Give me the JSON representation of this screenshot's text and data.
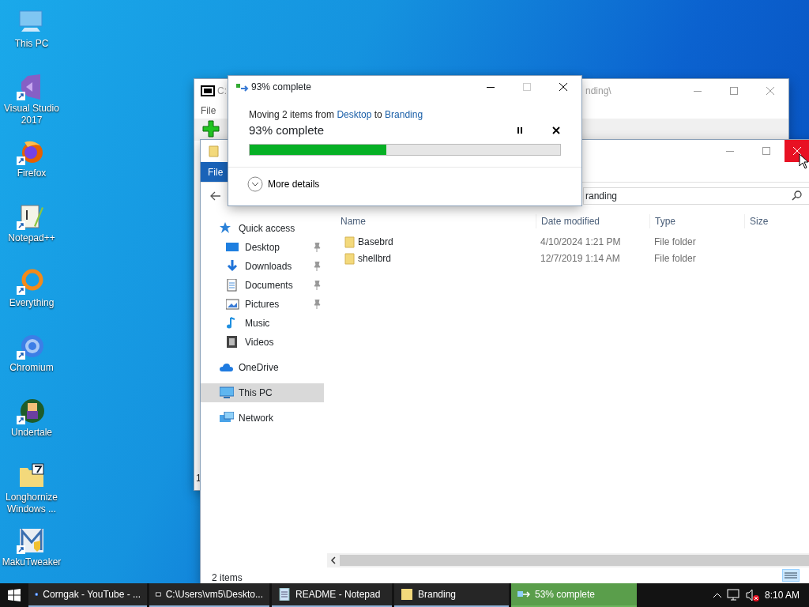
{
  "desktop_icons": [
    {
      "label": "This PC",
      "shortcut": false
    },
    {
      "label": "Visual Studio 2017",
      "shortcut": true
    },
    {
      "label": "Firefox",
      "shortcut": true
    },
    {
      "label": "Notepad++",
      "shortcut": true
    },
    {
      "label": "Everything",
      "shortcut": true
    },
    {
      "label": "Chromium",
      "shortcut": true
    },
    {
      "label": "Undertale",
      "shortcut": true
    },
    {
      "label": "Longhornize Windows ...",
      "shortcut": false
    },
    {
      "label": "MakuTweaker",
      "shortcut": true
    }
  ],
  "archive_window": {
    "title_start": "C:",
    "title_end": "nding\\",
    "menu": [
      "File"
    ],
    "status": "1"
  },
  "explorer": {
    "ribbon_tab": "File",
    "address": "randing",
    "close_hovered": true,
    "columns": [
      "Name",
      "Date modified",
      "Type",
      "Size"
    ],
    "nav": [
      {
        "label": "Quick access",
        "selected": false,
        "children": [
          {
            "label": "Desktop",
            "pinned": true,
            "selected": false
          },
          {
            "label": "Downloads",
            "pinned": true,
            "selected": false
          },
          {
            "label": "Documents",
            "pinned": true,
            "selected": false
          },
          {
            "label": "Pictures",
            "pinned": true,
            "selected": false
          },
          {
            "label": "Music",
            "pinned": false,
            "selected": false
          },
          {
            "label": "Videos",
            "pinned": false,
            "selected": false
          }
        ]
      },
      {
        "label": "OneDrive",
        "selected": false
      },
      {
        "label": "This PC",
        "selected": true
      },
      {
        "label": "Network",
        "selected": false
      }
    ],
    "rows": [
      {
        "name": "Basebrd",
        "date": "4/10/2024 1:21 PM",
        "type": "File folder"
      },
      {
        "name": "shellbrd",
        "date": "12/7/2019 1:14 AM",
        "type": "File folder"
      }
    ],
    "status": "2 items"
  },
  "dialog": {
    "title": "93% complete",
    "maximize_disabled": true,
    "message": {
      "prefix": "Moving 2 items from",
      "source": "Desktop",
      "middle": "to",
      "dest": "Branding"
    },
    "status": "93% complete",
    "level": 0.44,
    "details": "More details"
  },
  "taskbar": {
    "items": [
      {
        "label": "Corngak - YouTube - ...",
        "kind": "window"
      },
      {
        "label": "C:\\Users\\vm5\\Deskto...",
        "kind": "window"
      },
      {
        "label": "README - Notepad",
        "kind": "window"
      },
      {
        "label": "Branding",
        "kind": "window"
      },
      {
        "label": "53% complete",
        "kind": "progress"
      }
    ],
    "clock": "8:10 AM"
  }
}
